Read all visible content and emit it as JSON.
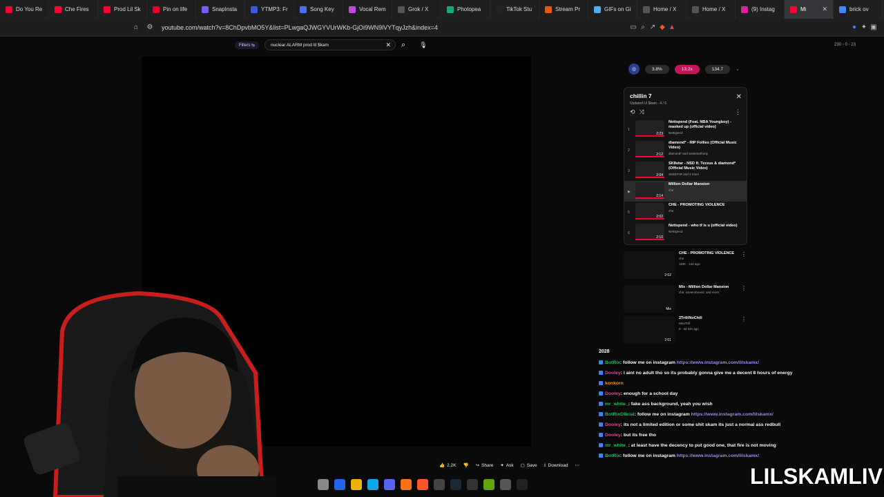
{
  "browser": {
    "tabs": [
      {
        "label": "Do You Re",
        "color": "#ff0033"
      },
      {
        "label": "Che Fires",
        "color": "#ff0033"
      },
      {
        "label": "Prod Lil Sk",
        "color": "#ff0033"
      },
      {
        "label": "Pin on life",
        "color": "#e60023"
      },
      {
        "label": "SnapInsta",
        "color": "#7c5cff"
      },
      {
        "label": "YTMP3: Fr",
        "color": "#3b5bdb"
      },
      {
        "label": "Song Key",
        "color": "#4c6ef5"
      },
      {
        "label": "Vocal Rem",
        "color": "#be4bdb"
      },
      {
        "label": "Grok / X",
        "color": "#555555"
      },
      {
        "label": "Photopea",
        "color": "#19a974"
      },
      {
        "label": "TikTok Stu",
        "color": "#222222"
      },
      {
        "label": "Stream Pr",
        "color": "#e8590c"
      },
      {
        "label": "GIFs on Gi",
        "color": "#4dabf7"
      },
      {
        "label": "Home / X",
        "color": "#555555"
      },
      {
        "label": "Home / X",
        "color": "#555555"
      },
      {
        "label": "(9) Instag",
        "color": "#d6249f"
      },
      {
        "label": "Mi",
        "color": "#ff0033",
        "active": true
      },
      {
        "label": "brick ov",
        "color": "#4285f4"
      }
    ],
    "url": "youtube.com/watch?v=8ChDpvbMO5Y&list=PLwgaQJWGYVUrWKb-GjOi9WN9lVYTqyJzh&index=4"
  },
  "youtube": {
    "filters_label": "Filters",
    "search_value": "nuclear ALARM prod lil $kam",
    "stats_text": "230 ◦ 0 ◦ 23",
    "actions": {
      "likes": "2.2K",
      "share": "Share",
      "ask": "Ask",
      "save": "Save",
      "download": "Download"
    },
    "speed": {
      "left": "3.8%",
      "mid": "13.2x",
      "right": "134.7"
    },
    "playlist": {
      "title": "chillin 7",
      "subtitle": "Updated  Lil $kam - 4 / 6",
      "items": [
        {
          "index": "1",
          "title": "Nettspend (Feat. NBA Youngboy) - masked up (official video)",
          "channel": "Nettspend",
          "duration": "2:23"
        },
        {
          "index": "2",
          "title": "diamond* - RIP Follies (Official Music Video)",
          "channel": "diamond* and xavieranthony",
          "duration": "2:12"
        },
        {
          "index": "3",
          "title": "SK8star - NSD ft. Tezzus & diamond* (Official Music Video)",
          "channel": "SK8STAR and 2 more",
          "duration": "2:04"
        },
        {
          "index": "▶",
          "title": "Million Dollar Mansion",
          "channel": "che",
          "duration": "2:14",
          "current": true
        },
        {
          "index": "5",
          "title": "CHE - PROMOTING VIOLENCE",
          "channel": "che",
          "duration": "2:02"
        },
        {
          "index": "6",
          "title": "Nettspend - who tf is u (official video)",
          "channel": "Nettspend",
          "duration": "2:10"
        }
      ]
    },
    "recommendations": [
      {
        "title": "CHE - PROMOTING VIOLENCE",
        "meta1": "che",
        "meta2": "110K · 12d ago",
        "duration": "2:02"
      },
      {
        "title": "Mix - Million Dollar Mansion",
        "meta1": "che, xavieroboxed, and more",
        "meta2": "",
        "duration": "Mix"
      },
      {
        "title": "2Trill/NoChill",
        "meta1": "MooTrill",
        "meta2": "0 · 34 min ago",
        "duration": "2:01"
      }
    ]
  },
  "chat": {
    "year": "2028",
    "messages": [
      {
        "user": "BotRix",
        "text": ": follow me on instagram ",
        "link": "https://www.instagram.com/lilskamx/",
        "user_color": "#22c55e"
      },
      {
        "user": "Dooley",
        "text": ": i aint no adult tho so its probably gonna give me a decent 8 hours of energy",
        "link": "",
        "user_color": "#ec4899"
      },
      {
        "user": "konkorn",
        "text": "",
        "link": "",
        "user_color": "#f59e0b"
      },
      {
        "user": "Dooley",
        "text": ": enough for a school day",
        "link": "",
        "user_color": "#ec4899"
      },
      {
        "user": "mr_white_",
        "text": ": fake ass background, yeah you wish",
        "link": "",
        "user_color": "#22c55e"
      },
      {
        "user": "BotRixOficial",
        "text": ": follow me on instagram ",
        "link": "https://www.instagram.com/lilskamx/",
        "user_color": "#22c55e"
      },
      {
        "user": "Dooley",
        "text": ": its not a limited edition or some shit skam its just a normal ass redbull",
        "link": "",
        "user_color": "#ec4899"
      },
      {
        "user": "Dooley",
        "text": ": but its free tho",
        "link": "",
        "user_color": "#ec4899"
      },
      {
        "user": "mr_white_",
        "text": ": at least have the decency to put good one, that fire is not moving",
        "link": "",
        "user_color": "#22c55e"
      },
      {
        "user": "BotRix",
        "text": ": follow me on instagram ",
        "link": "https://www.instagram.com/lilskamx/",
        "user_color": "#22c55e"
      }
    ]
  },
  "brand_text": "LILSKAMLIVE"
}
